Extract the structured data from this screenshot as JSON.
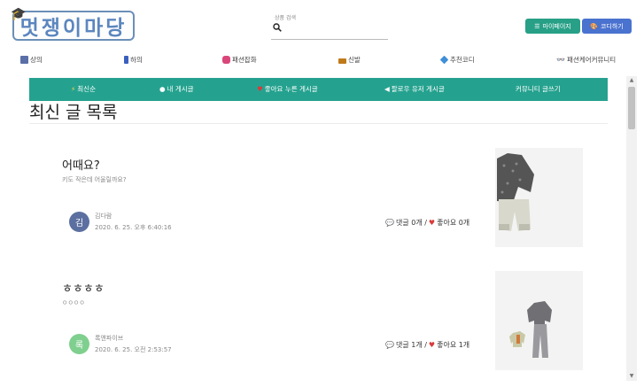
{
  "header": {
    "logo_text": "멋쟁이마당",
    "search_placeholder": "상품 검색",
    "mypage_label": "마이페이지",
    "cody_label": "코디하기"
  },
  "categories": [
    {
      "label": "상의",
      "icon": "shirt-icon",
      "color": "#5a6fa8"
    },
    {
      "label": "하의",
      "icon": "pants-icon",
      "color": "#3a5fbf"
    },
    {
      "label": "패션잡화",
      "icon": "bag-icon",
      "color": "#d9477a"
    },
    {
      "label": "신발",
      "icon": "shoe-icon",
      "color": "#c07a1a"
    },
    {
      "label": "추천코디",
      "icon": "diamond-icon",
      "color": "#3f8fd8"
    },
    {
      "label": "패션케어커뮤니티",
      "icon": "glasses-icon",
      "color": "#333333"
    }
  ],
  "tabs": [
    {
      "label": "최신순",
      "icon": "lightning-icon"
    },
    {
      "label": "내 게시글",
      "icon": "speech-bubble-icon"
    },
    {
      "label": "좋아요 누른 게시글",
      "icon": "heart-icon"
    },
    {
      "label": "팔로우 유저 게시글",
      "icon": "megaphone-icon"
    },
    {
      "label": "커뮤니티 글쓰기",
      "icon": ""
    }
  ],
  "main": {
    "title": "최신 글 목록"
  },
  "posts": [
    {
      "title": "어때요?",
      "subtitle": "키도 작은데 어울릴까요?",
      "avatar_letter": "김",
      "avatar_color": "#5b6fa0",
      "author": "김다람",
      "date": "2020. 6. 25. 오후 6:40:16",
      "comments_label": "댓글 0개 /",
      "likes_label": "좋아요 0개"
    },
    {
      "title": "ㅎㅎㅎㅎ",
      "subtitle": "ㅇㅇㅇㅇ",
      "avatar_letter": "록",
      "avatar_color": "#7fcf8f",
      "author": "록앤파이브",
      "date": "2020. 6. 25. 오전 2:53:57",
      "comments_label": "댓글 1개 /",
      "likes_label": "좋아요 1개"
    }
  ],
  "colors": {
    "tab_bar": "#25a28f",
    "mypage_button": "#27a087",
    "cody_button": "#4a72cf"
  }
}
